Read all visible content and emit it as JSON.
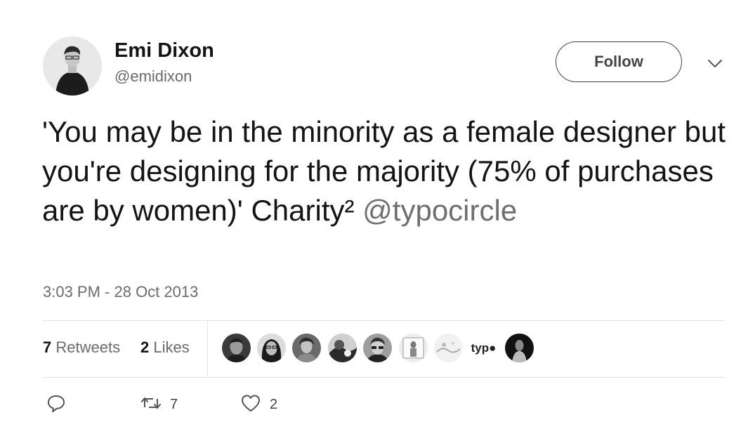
{
  "author": {
    "display_name": "Emi Dixon",
    "handle": "@emidixon"
  },
  "follow_label": "Follow",
  "tweet": {
    "text": "'You may be in the minority as a female designer but you're designing for the majority (75% of purchases are by women)' Charity² ",
    "mention": "@typocircle",
    "timestamp": "3:03 PM - 28 Oct 2013"
  },
  "stats": {
    "retweets_count": "7",
    "retweets_label": "Retweets",
    "likes_count": "2",
    "likes_label": "Likes"
  },
  "likers": {
    "logo_text": "typ●"
  },
  "actions": {
    "retweet_count": "7",
    "like_count": "2"
  },
  "icons": [
    "chevron-down-icon",
    "reply-icon",
    "retweet-icon",
    "heart-icon"
  ],
  "colors": {
    "text": "#141414",
    "secondary": "#6b6b6b",
    "divider": "#e3e3e3"
  }
}
